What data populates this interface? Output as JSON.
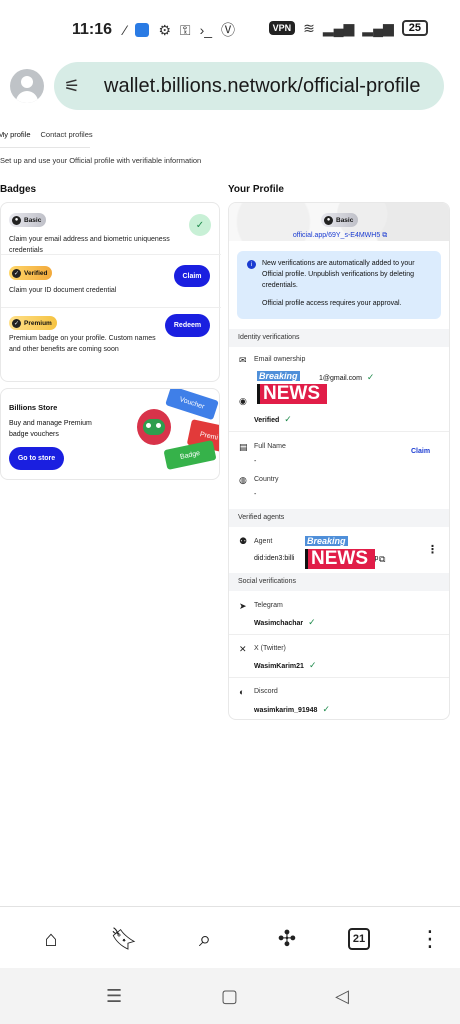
{
  "status_bar": {
    "time": "11:16",
    "vpn": "VPN",
    "battery": "25"
  },
  "browser": {
    "url": "wallet.billions.network/official-profile"
  },
  "tabs": [
    {
      "label": "My profile"
    },
    {
      "label": "Contact profiles"
    }
  ],
  "subtitle": "Set up and use your Official profile with verifiable information",
  "badges": {
    "heading": "Badges",
    "items": [
      {
        "name": "Basic",
        "desc": "Claim your email address and biometric uniqueness credentials"
      },
      {
        "name": "Verified",
        "desc": "Claim your ID document credential",
        "action": "Claim"
      },
      {
        "name": "Premium",
        "desc": "Premium badge on your profile. Custom names and other benefits are coming soon",
        "action": "Redeem"
      }
    ]
  },
  "store": {
    "title": "Billions Store",
    "desc": "Buy and manage Premium badge vouchers",
    "button": "Go to store",
    "tickets": [
      "Voucher",
      "Premi",
      "Badge"
    ]
  },
  "profile": {
    "heading": "Your Profile",
    "badge": "Basic",
    "did": "official.app/69Y_s-E4MWH5",
    "info": "New verifications are automatically added to your Official profile. Unpublish verifications by deleting credentials.",
    "info2": "Official profile access requires your approval.",
    "identity_heading": "Identity verifications",
    "email_label": "Email ownership",
    "email_value": "1@gmail.com",
    "uniqueness_value": "Verified",
    "fullname_label": "Full Name",
    "fullname_value": "-",
    "fullname_action": "Claim",
    "country_label": "Country",
    "country_value": "-",
    "agents_heading": "Verified agents",
    "agent_label": "Agent",
    "agent_value_left": "did:iden3:billi",
    "agent_value_right": "0Pp",
    "social_heading": "Social verifications",
    "telegram_label": "Telegram",
    "telegram_value": "Wasimchachar",
    "x_label": "X (Twitter)",
    "x_value": "WasimKarim21",
    "discord_label": "Discord",
    "discord_value": "wasimkarim_91948"
  },
  "overlay": {
    "breaking": "Breaking",
    "news": "NEWS"
  },
  "bottom_nav": {
    "tab_count": "21"
  }
}
